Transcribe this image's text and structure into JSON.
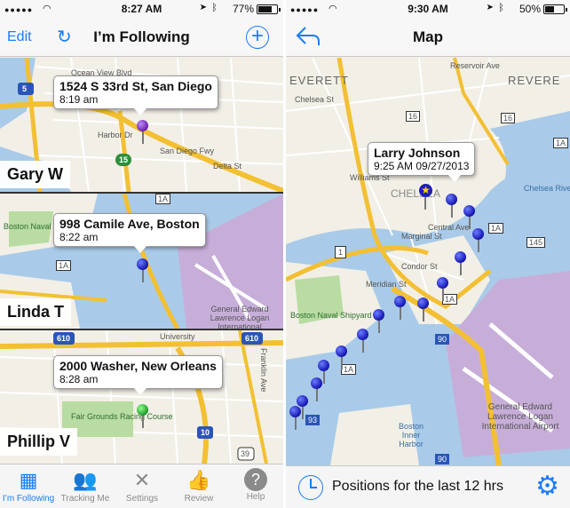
{
  "left": {
    "status": {
      "time": "8:27 AM",
      "battery": "77%",
      "battery_level": 0.77
    },
    "nav": {
      "edit": "Edit",
      "title": "I’m Following"
    },
    "entries": [
      {
        "name": "Gary W",
        "address": "1524 S 33rd St, San Diego",
        "time": "8:19 am",
        "pin_color": "#7b2fbf",
        "map_labels": [
          "Ocean View Blvd",
          "Delta St",
          "Harbor Dr",
          "San Diego Fwy",
          "5",
          "15"
        ]
      },
      {
        "name": "Linda T",
        "address": "998 Camile Ave, Boston",
        "time": "8:22 am",
        "pin_color": "#1c1cc4",
        "map_labels": [
          "Boston Naval Shipyard",
          "1A",
          "1A",
          "General Edward Lawrence Logan International"
        ]
      },
      {
        "name": "Phillip V",
        "address": "2000 Washer, New Orleans",
        "time": "8:28 am",
        "pin_color": "#1eaa2a",
        "map_labels": [
          "610",
          "610",
          "University",
          "Franklin Ave",
          "Fair Grounds Racing Course",
          "10",
          "39"
        ]
      }
    ],
    "tabs": [
      {
        "label": "I’m Following",
        "icon": "map-icon",
        "active": true
      },
      {
        "label": "Tracking Me",
        "icon": "people-icon",
        "active": false
      },
      {
        "label": "Settings",
        "icon": "tools-icon",
        "active": false
      },
      {
        "label": "Review",
        "icon": "thumbs-up-icon",
        "active": false
      },
      {
        "label": "Help",
        "icon": "help-icon",
        "active": false
      }
    ]
  },
  "right": {
    "status": {
      "time": "9:30 AM",
      "battery": "50%",
      "battery_level": 0.5
    },
    "nav": {
      "title": "Map"
    },
    "callout": {
      "name": "Larry Johnson",
      "time": "9:25 AM 09/27/2013"
    },
    "map_labels": [
      "EVERETT",
      "REVERE",
      "Chelsea St",
      "Reservoir Ave",
      "16",
      "16",
      "1A",
      "1A",
      "1A",
      "1A",
      "145",
      "1",
      "90",
      "90",
      "93",
      "CHELSEA",
      "Central Ave",
      "Marginal St",
      "Condor St",
      "Williams St",
      "Meridian St",
      "Chelsea River",
      "Boston Naval Shipyard",
      "General Edward Lawrence Logan International Airport",
      "Boston Inner Harbor"
    ],
    "bottom": {
      "text": "Positions for the last 12 hrs"
    }
  },
  "colors": {
    "accent": "#1a7cf7",
    "water": "#a9cbe9",
    "land": "#f2efe6",
    "airport": "#c7aed9",
    "highway": "#f3c033",
    "park": "#b9dca2"
  }
}
